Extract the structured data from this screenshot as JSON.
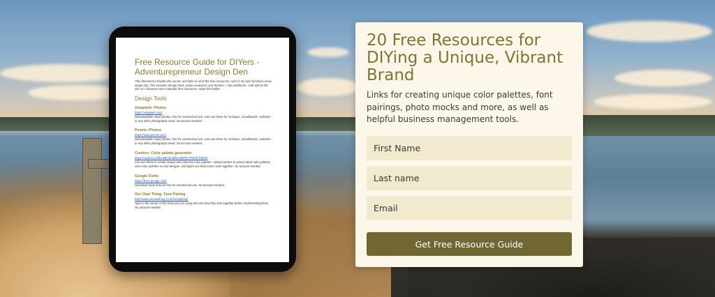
{
  "document": {
    "title": "Free Resource Guide for DIYers - Adventurepreneur Design Den",
    "intro": "This document includes the names and links to all of the free resources I use in my own business every single day. This includes design tools, photo resources and System + Ops platforms. I will add to this doc as I discover more valuable free resources. Hope this helps!",
    "section_heading": "Design Tools",
    "resources": [
      {
        "name": "Unsplash: Photos",
        "url": "https://unsplash.com/",
        "description": "Downloadable stock photos, free for commercial use. Can use these for mockups, moodboards, websites or any other photography need. No account needed."
      },
      {
        "name": "Pexels: Photos",
        "url": "https://www.pexels.com/",
        "description": "Downloadable stock photos, free for commercial use. Can use these for mockups, moodboards, websites or any other photography need. No account needed."
      },
      {
        "name": "Coolors: Color palette generator",
        "url": "https://coolors.co/dbcad9-d142f9-a3fed9-7700cb-f76400",
        "description": "Can use these to create unique and cohesive color palettes. Upload photos to extract ideal color palettes, view color palettes on real designs, and figure out what colors work together. No account needed."
      },
      {
        "name": "Google Fonts",
        "url": "https://fonts.google.com/",
        "description": "Download fonts that are free for commercial use. No account needed."
      },
      {
        "name": "Our Own Thing: Font Pairing",
        "url": "http://www.ourownthing.co.uk/fontpairing/",
        "description": "Type in the names of the fonts you are using and see how they look together before implementing them. No account needed."
      }
    ]
  },
  "signup": {
    "title": "20 Free Resources for DIYing a Unique, Vibrant Brand",
    "description": "Links for creating unique color palettes, font pairings, photo mocks and more, as well as helpful business management tools.",
    "first_name_placeholder": "First Name",
    "last_name_placeholder": "Last name",
    "email_placeholder": "Email",
    "submit_label": "Get Free Resource Guide"
  },
  "colors": {
    "accent": "#706733",
    "title": "#7e7434",
    "card_bg": "#fcf7e8",
    "field_bg": "#f1eacf"
  }
}
